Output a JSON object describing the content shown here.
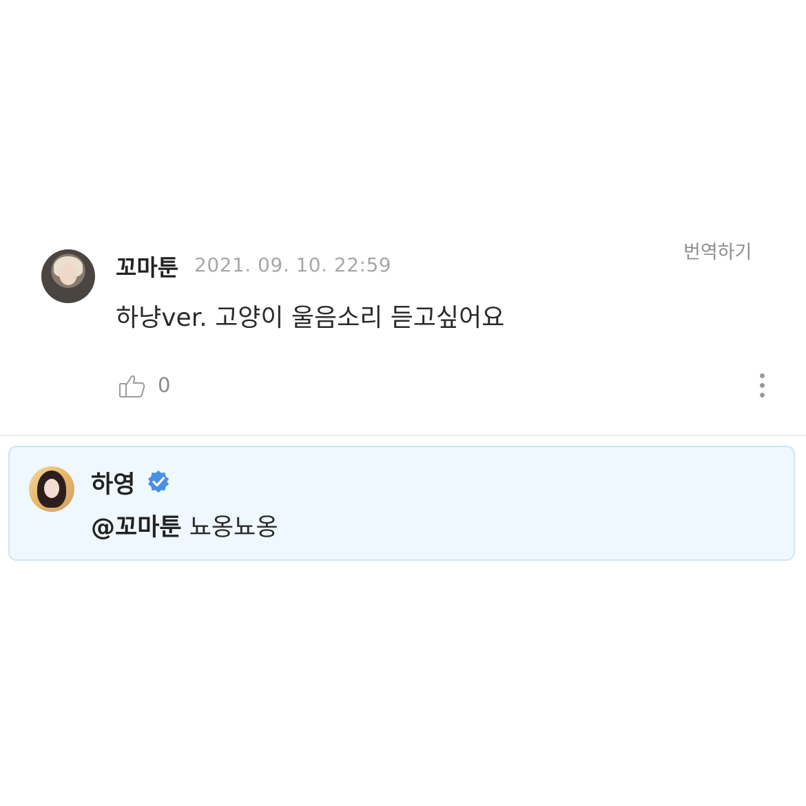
{
  "comment": {
    "author": "꼬마툰",
    "timestamp": "2021. 09. 10. 22:59",
    "translate_label": "번역하기",
    "text": "하냥ver. 고양이 울음소리 듣고싶어요",
    "like_count": "0",
    "like_icon": "thumbs-up-icon",
    "more_icon": "more-vertical-icon"
  },
  "reply": {
    "author": "하영",
    "verified_icon": "verified-badge-icon",
    "mention": "@꼬마툰",
    "text": " 뇨옹뇨옹",
    "accent_color": "#4a90e2",
    "background_color": "#eef8fe"
  }
}
